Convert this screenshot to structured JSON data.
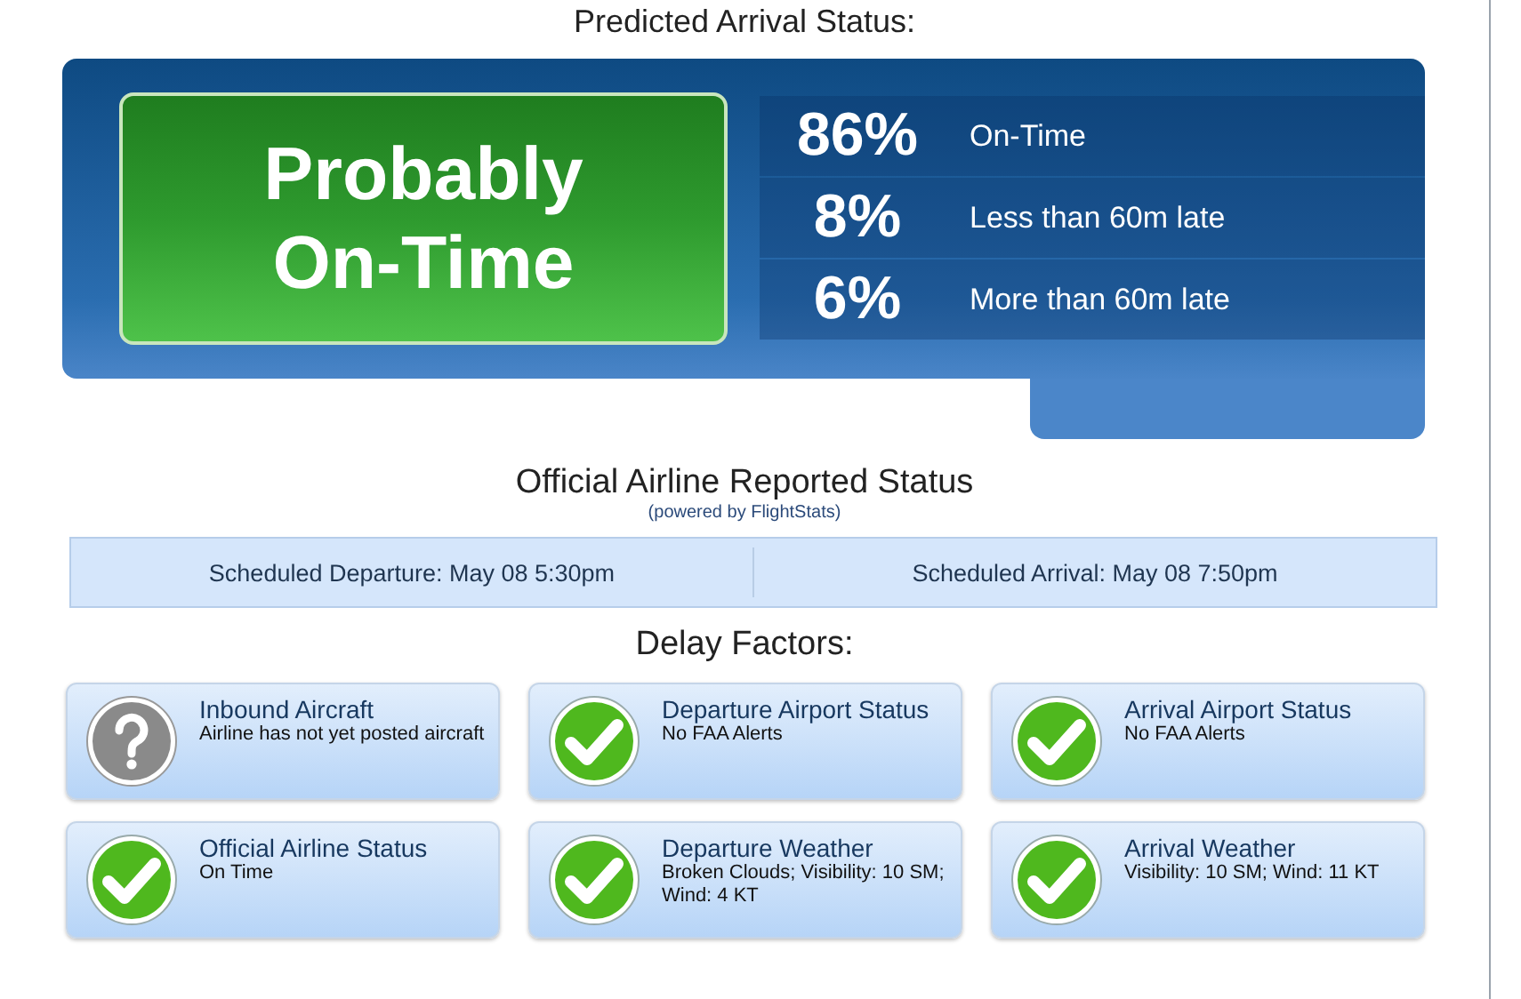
{
  "predicted": {
    "title": "Predicted Arrival Status:",
    "verdict": "Probably On-Time",
    "rows": [
      {
        "percent": "86%",
        "label": "On-Time"
      },
      {
        "percent": "8%",
        "label": "Less than 60m late"
      },
      {
        "percent": "6%",
        "label": "More than 60m late"
      }
    ]
  },
  "official": {
    "title": "Official Airline Reported Status",
    "subtitle": "(powered by FlightStats)",
    "departure": "Scheduled Departure: May 08 5:30pm",
    "arrival": "Scheduled Arrival: May 08 7:50pm"
  },
  "delay_factors": {
    "title": "Delay Factors:",
    "items": [
      {
        "kind": "unknown",
        "title": "Inbound Aircraft",
        "detail": "Airline has not yet posted aircraft"
      },
      {
        "kind": "ok",
        "title": "Departure Airport Status",
        "detail": "No FAA Alerts"
      },
      {
        "kind": "ok",
        "title": "Arrival Airport Status",
        "detail": "No FAA Alerts"
      },
      {
        "kind": "ok",
        "title": "Official Airline Status",
        "detail": "On Time"
      },
      {
        "kind": "ok",
        "title": "Departure Weather",
        "detail": "Broken Clouds; Visibility: 10 SM; Wind: 4 KT"
      },
      {
        "kind": "ok",
        "title": "Arrival Weather",
        "detail": "Visibility: 10 SM; Wind: 11 KT"
      }
    ]
  }
}
